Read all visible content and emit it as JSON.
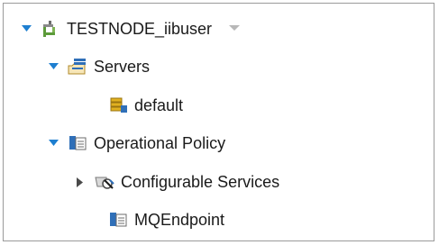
{
  "tree": {
    "root": {
      "label": "TESTNODE_iibuser",
      "icon": "integration-node-icon",
      "expanded": true
    },
    "items": [
      {
        "label": "Servers",
        "icon": "servers-folder-icon",
        "expanded": true
      },
      {
        "label": "default",
        "icon": "integration-server-icon"
      },
      {
        "label": "Operational Policy",
        "icon": "operational-policy-icon",
        "expanded": true
      },
      {
        "label": "Configurable Services",
        "icon": "configurable-services-icon",
        "expanded": false
      },
      {
        "label": "MQEndpoint",
        "icon": "mqendpoint-icon"
      }
    ]
  },
  "colors": {
    "twisty_blue": "#1e7fd0",
    "twisty_gray": "#4a4a4a",
    "menu_arrow": "#b8b8b8",
    "icon_blue": "#2f6fb8",
    "icon_gold": "#e0b020"
  }
}
